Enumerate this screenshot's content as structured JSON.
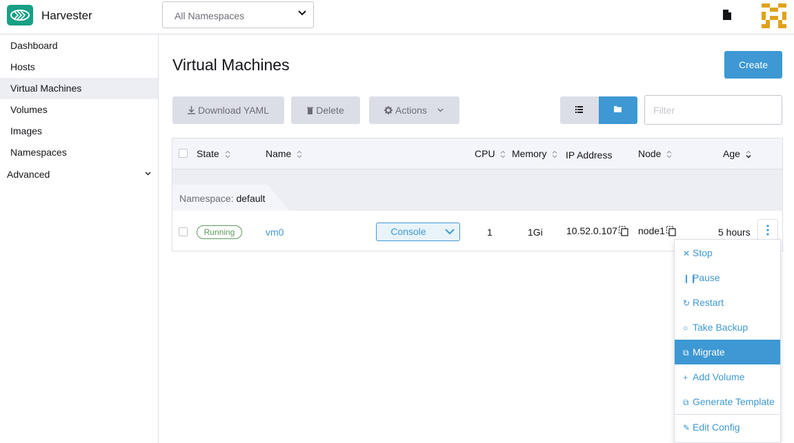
{
  "header": {
    "brand": "Harvester",
    "namespace_select": "All Namespaces"
  },
  "sidebar": {
    "items": [
      {
        "label": "Dashboard"
      },
      {
        "label": "Hosts"
      },
      {
        "label": "Virtual Machines",
        "active": true
      },
      {
        "label": "Volumes"
      },
      {
        "label": "Images"
      },
      {
        "label": "Namespaces"
      }
    ],
    "group": "Advanced"
  },
  "main": {
    "title": "Virtual Machines",
    "create_label": "Create",
    "toolbar": {
      "download_label": "Download YAML",
      "delete_label": "Delete",
      "actions_label": "Actions"
    },
    "filter_placeholder": "Filter"
  },
  "table": {
    "columns": {
      "state": "State",
      "name": "Name",
      "cpu": "CPU",
      "memory": "Memory",
      "ip": "IP Address",
      "node": "Node",
      "age": "Age"
    },
    "group_prefix": "Namespace:",
    "group_name": "default",
    "rows": [
      {
        "state": "Running",
        "name": "vm0",
        "console": "Console",
        "cpu": "1",
        "memory": "1Gi",
        "ip": "10.52.0.107",
        "node": "node1",
        "age": "5 hours"
      }
    ]
  },
  "menu": {
    "items": [
      {
        "label": "Stop",
        "icon": "close-icon"
      },
      {
        "label": "Pause",
        "icon": "pause-icon"
      },
      {
        "label": "Restart",
        "icon": "refresh-icon"
      },
      {
        "label": "Take Backup",
        "icon": "backup-icon"
      },
      {
        "label": "Migrate",
        "icon": "migrate-icon",
        "highlighted": true
      },
      {
        "label": "Add Volume",
        "icon": "plus-icon"
      },
      {
        "label": "Generate Template",
        "icon": "template-icon"
      },
      {
        "label": "Edit Config",
        "icon": "pencil-icon"
      }
    ]
  },
  "colors": {
    "accent": "#3d98d3",
    "brand": "#16a085",
    "running": "#5d995d"
  }
}
